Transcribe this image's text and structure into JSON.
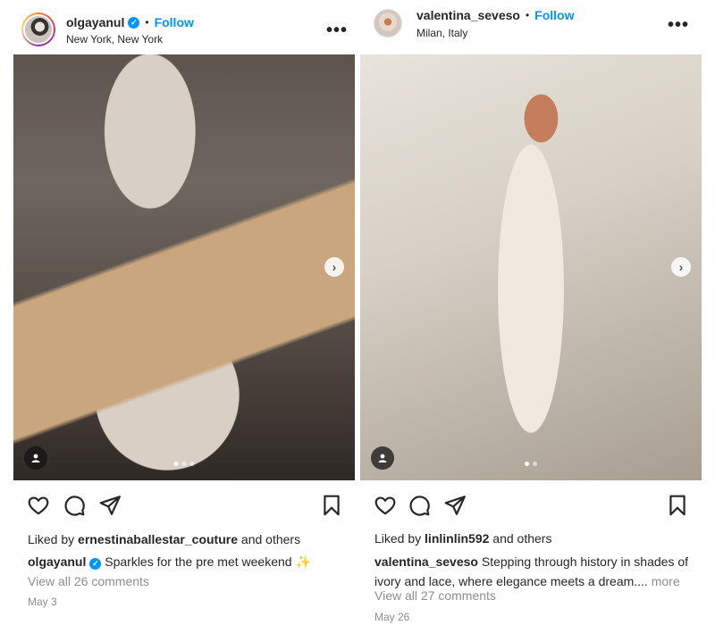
{
  "posts": [
    {
      "username": "olgayanul",
      "verified": true,
      "follow_label": "Follow",
      "location": "New York, New York",
      "more_icon": "more-horizontal-icon",
      "liked_by_prefix": "Liked by",
      "liked_by_user": "ernestinaballestar_couture",
      "liked_by_suffix": "and others",
      "caption_username": "olgayanul",
      "caption_text": "Sparkles for the pre met weekend",
      "caption_emoji": "✨",
      "view_comments": "View all 26 comments",
      "date": "May 3",
      "carousel_total": 3,
      "carousel_active": 1
    },
    {
      "username": "valentina_seveso",
      "verified": false,
      "follow_label": "Follow",
      "location": "Milan, Italy",
      "more_icon": "more-horizontal-icon",
      "liked_by_prefix": "Liked by",
      "liked_by_user": "linlinlin592",
      "liked_by_suffix": "and others",
      "caption_username": "valentina_seveso",
      "caption_text": "Stepping through history in shades of ivory and lace, where elegance meets a dream....",
      "caption_more": "more",
      "view_comments": "View all 27 comments",
      "date": "May 26",
      "carousel_total": 2,
      "carousel_active": 1
    }
  ],
  "colors": {
    "accent": "#0095f6",
    "text": "#262626",
    "muted": "#8e8e8e"
  },
  "icons": {
    "like": "heart-icon",
    "comment": "comment-icon",
    "share": "send-icon",
    "save": "bookmark-icon",
    "tag": "user-tag-icon",
    "next": "chevron-right-icon"
  }
}
